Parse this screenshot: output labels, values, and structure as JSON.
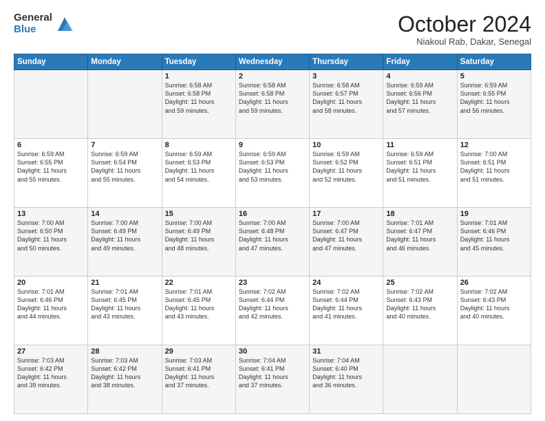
{
  "header": {
    "logo_general": "General",
    "logo_blue": "Blue",
    "month_title": "October 2024",
    "subtitle": "Niakoul Rab, Dakar, Senegal"
  },
  "days_of_week": [
    "Sunday",
    "Monday",
    "Tuesday",
    "Wednesday",
    "Thursday",
    "Friday",
    "Saturday"
  ],
  "weeks": [
    [
      {
        "day": "",
        "sunrise": "",
        "sunset": "",
        "daylight": ""
      },
      {
        "day": "",
        "sunrise": "",
        "sunset": "",
        "daylight": ""
      },
      {
        "day": "1",
        "sunrise": "Sunrise: 6:58 AM",
        "sunset": "Sunset: 6:58 PM",
        "daylight": "Daylight: 11 hours and 59 minutes."
      },
      {
        "day": "2",
        "sunrise": "Sunrise: 6:58 AM",
        "sunset": "Sunset: 6:58 PM",
        "daylight": "Daylight: 11 hours and 59 minutes."
      },
      {
        "day": "3",
        "sunrise": "Sunrise: 6:58 AM",
        "sunset": "Sunset: 6:57 PM",
        "daylight": "Daylight: 11 hours and 58 minutes."
      },
      {
        "day": "4",
        "sunrise": "Sunrise: 6:59 AM",
        "sunset": "Sunset: 6:56 PM",
        "daylight": "Daylight: 11 hours and 57 minutes."
      },
      {
        "day": "5",
        "sunrise": "Sunrise: 6:59 AM",
        "sunset": "Sunset: 6:55 PM",
        "daylight": "Daylight: 11 hours and 56 minutes."
      }
    ],
    [
      {
        "day": "6",
        "sunrise": "Sunrise: 6:59 AM",
        "sunset": "Sunset: 6:55 PM",
        "daylight": "Daylight: 11 hours and 55 minutes."
      },
      {
        "day": "7",
        "sunrise": "Sunrise: 6:59 AM",
        "sunset": "Sunset: 6:54 PM",
        "daylight": "Daylight: 11 hours and 55 minutes."
      },
      {
        "day": "8",
        "sunrise": "Sunrise: 6:59 AM",
        "sunset": "Sunset: 6:53 PM",
        "daylight": "Daylight: 11 hours and 54 minutes."
      },
      {
        "day": "9",
        "sunrise": "Sunrise: 6:59 AM",
        "sunset": "Sunset: 6:53 PM",
        "daylight": "Daylight: 11 hours and 53 minutes."
      },
      {
        "day": "10",
        "sunrise": "Sunrise: 6:59 AM",
        "sunset": "Sunset: 6:52 PM",
        "daylight": "Daylight: 11 hours and 52 minutes."
      },
      {
        "day": "11",
        "sunrise": "Sunrise: 6:59 AM",
        "sunset": "Sunset: 6:51 PM",
        "daylight": "Daylight: 11 hours and 51 minutes."
      },
      {
        "day": "12",
        "sunrise": "Sunrise: 7:00 AM",
        "sunset": "Sunset: 6:51 PM",
        "daylight": "Daylight: 11 hours and 51 minutes."
      }
    ],
    [
      {
        "day": "13",
        "sunrise": "Sunrise: 7:00 AM",
        "sunset": "Sunset: 6:50 PM",
        "daylight": "Daylight: 11 hours and 50 minutes."
      },
      {
        "day": "14",
        "sunrise": "Sunrise: 7:00 AM",
        "sunset": "Sunset: 6:49 PM",
        "daylight": "Daylight: 11 hours and 49 minutes."
      },
      {
        "day": "15",
        "sunrise": "Sunrise: 7:00 AM",
        "sunset": "Sunset: 6:49 PM",
        "daylight": "Daylight: 11 hours and 48 minutes."
      },
      {
        "day": "16",
        "sunrise": "Sunrise: 7:00 AM",
        "sunset": "Sunset: 6:48 PM",
        "daylight": "Daylight: 11 hours and 47 minutes."
      },
      {
        "day": "17",
        "sunrise": "Sunrise: 7:00 AM",
        "sunset": "Sunset: 6:47 PM",
        "daylight": "Daylight: 11 hours and 47 minutes."
      },
      {
        "day": "18",
        "sunrise": "Sunrise: 7:01 AM",
        "sunset": "Sunset: 6:47 PM",
        "daylight": "Daylight: 11 hours and 46 minutes."
      },
      {
        "day": "19",
        "sunrise": "Sunrise: 7:01 AM",
        "sunset": "Sunset: 6:46 PM",
        "daylight": "Daylight: 11 hours and 45 minutes."
      }
    ],
    [
      {
        "day": "20",
        "sunrise": "Sunrise: 7:01 AM",
        "sunset": "Sunset: 6:46 PM",
        "daylight": "Daylight: 11 hours and 44 minutes."
      },
      {
        "day": "21",
        "sunrise": "Sunrise: 7:01 AM",
        "sunset": "Sunset: 6:45 PM",
        "daylight": "Daylight: 11 hours and 43 minutes."
      },
      {
        "day": "22",
        "sunrise": "Sunrise: 7:01 AM",
        "sunset": "Sunset: 6:45 PM",
        "daylight": "Daylight: 11 hours and 43 minutes."
      },
      {
        "day": "23",
        "sunrise": "Sunrise: 7:02 AM",
        "sunset": "Sunset: 6:44 PM",
        "daylight": "Daylight: 11 hours and 42 minutes."
      },
      {
        "day": "24",
        "sunrise": "Sunrise: 7:02 AM",
        "sunset": "Sunset: 6:44 PM",
        "daylight": "Daylight: 11 hours and 41 minutes."
      },
      {
        "day": "25",
        "sunrise": "Sunrise: 7:02 AM",
        "sunset": "Sunset: 6:43 PM",
        "daylight": "Daylight: 11 hours and 40 minutes."
      },
      {
        "day": "26",
        "sunrise": "Sunrise: 7:02 AM",
        "sunset": "Sunset: 6:43 PM",
        "daylight": "Daylight: 11 hours and 40 minutes."
      }
    ],
    [
      {
        "day": "27",
        "sunrise": "Sunrise: 7:03 AM",
        "sunset": "Sunset: 6:42 PM",
        "daylight": "Daylight: 11 hours and 39 minutes."
      },
      {
        "day": "28",
        "sunrise": "Sunrise: 7:03 AM",
        "sunset": "Sunset: 6:42 PM",
        "daylight": "Daylight: 11 hours and 38 minutes."
      },
      {
        "day": "29",
        "sunrise": "Sunrise: 7:03 AM",
        "sunset": "Sunset: 6:41 PM",
        "daylight": "Daylight: 11 hours and 37 minutes."
      },
      {
        "day": "30",
        "sunrise": "Sunrise: 7:04 AM",
        "sunset": "Sunset: 6:41 PM",
        "daylight": "Daylight: 11 hours and 37 minutes."
      },
      {
        "day": "31",
        "sunrise": "Sunrise: 7:04 AM",
        "sunset": "Sunset: 6:40 PM",
        "daylight": "Daylight: 11 hours and 36 minutes."
      },
      {
        "day": "",
        "sunrise": "",
        "sunset": "",
        "daylight": ""
      },
      {
        "day": "",
        "sunrise": "",
        "sunset": "",
        "daylight": ""
      }
    ]
  ]
}
